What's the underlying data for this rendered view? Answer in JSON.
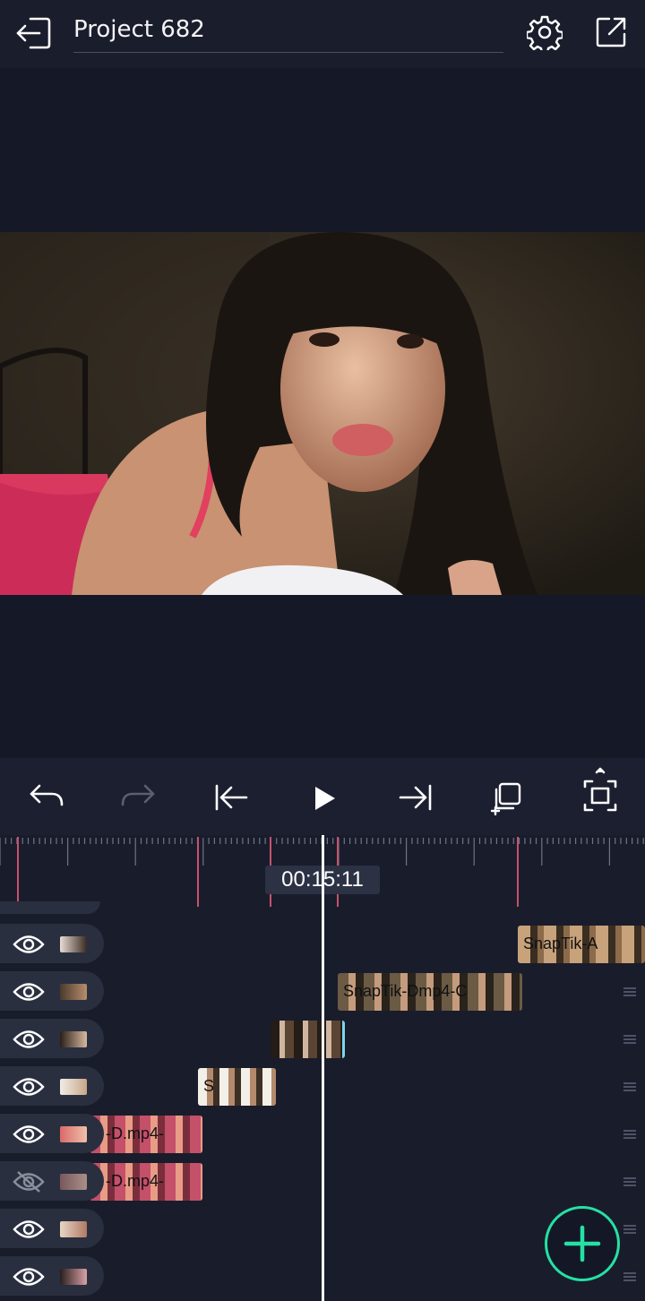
{
  "header": {
    "title": "Project 682",
    "icons": {
      "back": "exit-arrow-icon",
      "settings": "gear-icon",
      "share": "share-icon"
    }
  },
  "controls": [
    "undo-icon",
    "redo-icon",
    "jump-start-icon",
    "play-icon",
    "jump-end-icon",
    "duplicate-icon",
    "fullscreen-icon"
  ],
  "timeline": {
    "timecode": "00:15:11",
    "tracks": [
      {
        "visible": true,
        "clip_label": "SnapTik-A"
      },
      {
        "visible": true,
        "clip_label": "SnapTik-Dmp4-C"
      },
      {
        "visible": true,
        "clip_label": ""
      },
      {
        "visible": true,
        "clip_label": "S"
      },
      {
        "visible": true,
        "clip_label": "-D.mp4-"
      },
      {
        "visible": false,
        "clip_label": "-D.mp4-"
      },
      {
        "visible": true,
        "clip_label": ""
      },
      {
        "visible": true,
        "clip_label": ""
      }
    ]
  },
  "colors": {
    "accent": "#26e0a4",
    "marker": "#c8506d",
    "background": "#181b2a"
  },
  "fab": {
    "icon": "plus-icon"
  }
}
